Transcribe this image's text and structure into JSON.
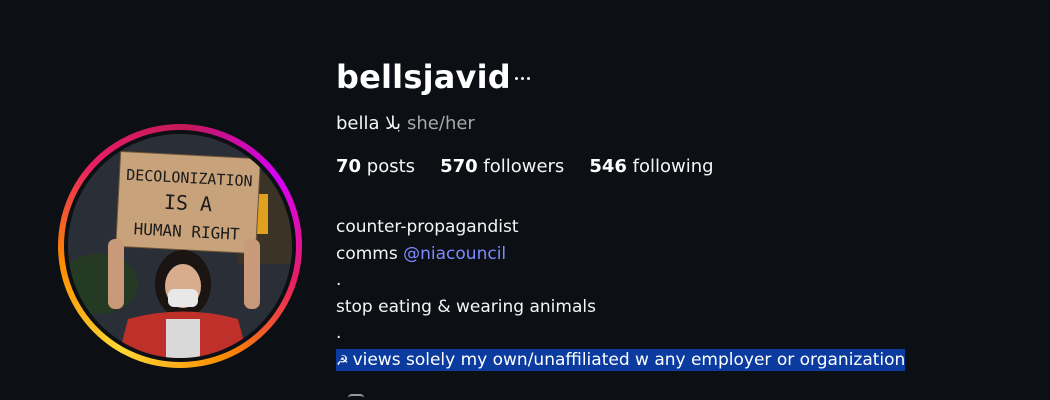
{
  "profile": {
    "username": "bellsjavid",
    "display_name": "bella بلا",
    "pronouns": "she/her",
    "avatar_sign_text": [
      "DECOLONIZATION",
      "IS A",
      "HUMAN RIGHT"
    ]
  },
  "stats": {
    "posts_count": "70",
    "posts_label": "posts",
    "followers_count": "570",
    "followers_label": "followers",
    "following_count": "546",
    "following_label": "following"
  },
  "bio": {
    "line1": "counter-propagandist",
    "line2_prefix": "comms ",
    "line2_mention": "@niacouncil",
    "line3": ".",
    "line4": "stop eating & wearing animals",
    "line5": ".",
    "line6_icon": "☭",
    "line6_text": "views solely my own/unaffiliated w any employer or organization"
  },
  "icons": {
    "more_options": "ellipsis-icon"
  },
  "colors": {
    "background": "#0c0f14",
    "mention": "#7c8cff",
    "selection": "#0b3b9e"
  }
}
